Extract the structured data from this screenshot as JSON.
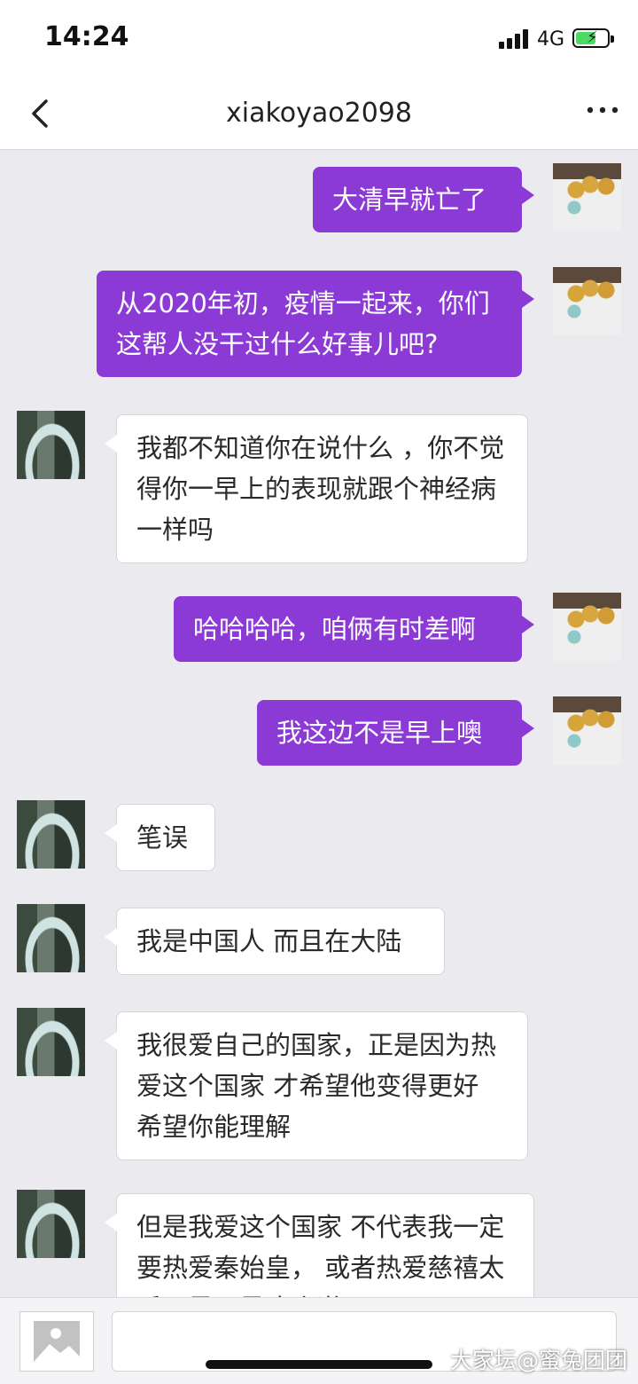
{
  "status_bar": {
    "time": "14:24",
    "network": "4G"
  },
  "header": {
    "title": "xiakoyao2098"
  },
  "messages": [
    {
      "from": "me",
      "text": "大清早就亡了"
    },
    {
      "from": "me",
      "text": "从2020年初，疫情一起来，你们这帮人没干过什么好事儿吧?"
    },
    {
      "from": "other",
      "text": "我都不知道你在说什么 ，你不觉得你一早上的表现就跟个神经病一样吗"
    },
    {
      "from": "me",
      "text": "哈哈哈哈，咱俩有时差啊"
    },
    {
      "from": "me",
      "text": "我这边不是早上噢"
    },
    {
      "from": "other",
      "text": "笔误"
    },
    {
      "from": "other",
      "text": "我是中国人 而且在大陆"
    },
    {
      "from": "other",
      "text": "我很爱自己的国家，正是因为热爱这个国家 才希望他变得更好 希望你能理解"
    },
    {
      "from": "other",
      "text": "但是我爱这个国家 不代表我一定要热爱秦始皇， 或者热爱慈禧太后，是不是这个道理呢？"
    }
  ],
  "watermark": "大家坛@蜜兔团团",
  "colors": {
    "outgoing_bubble": "#8c3ad6",
    "background": "#ebebef"
  },
  "icons": [
    "back-chevron-icon",
    "more-icon",
    "image-picker-icon",
    "battery-charging-icon",
    "signal-icon"
  ]
}
